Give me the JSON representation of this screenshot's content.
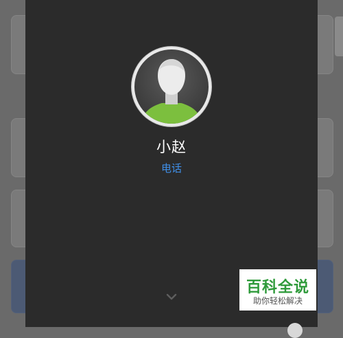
{
  "contact": {
    "name": "小赵",
    "label": "电话"
  },
  "icons": {
    "avatar": "default-person-avatar-icon",
    "expand": "chevron-down-icon"
  },
  "colors": {
    "overlay_bg": "#2b2b2b",
    "accent": "#3f8fe8",
    "avatar_shirt": "#7cbf3e"
  },
  "watermark": {
    "main": "百科全说",
    "sub": "助你轻松解决"
  }
}
